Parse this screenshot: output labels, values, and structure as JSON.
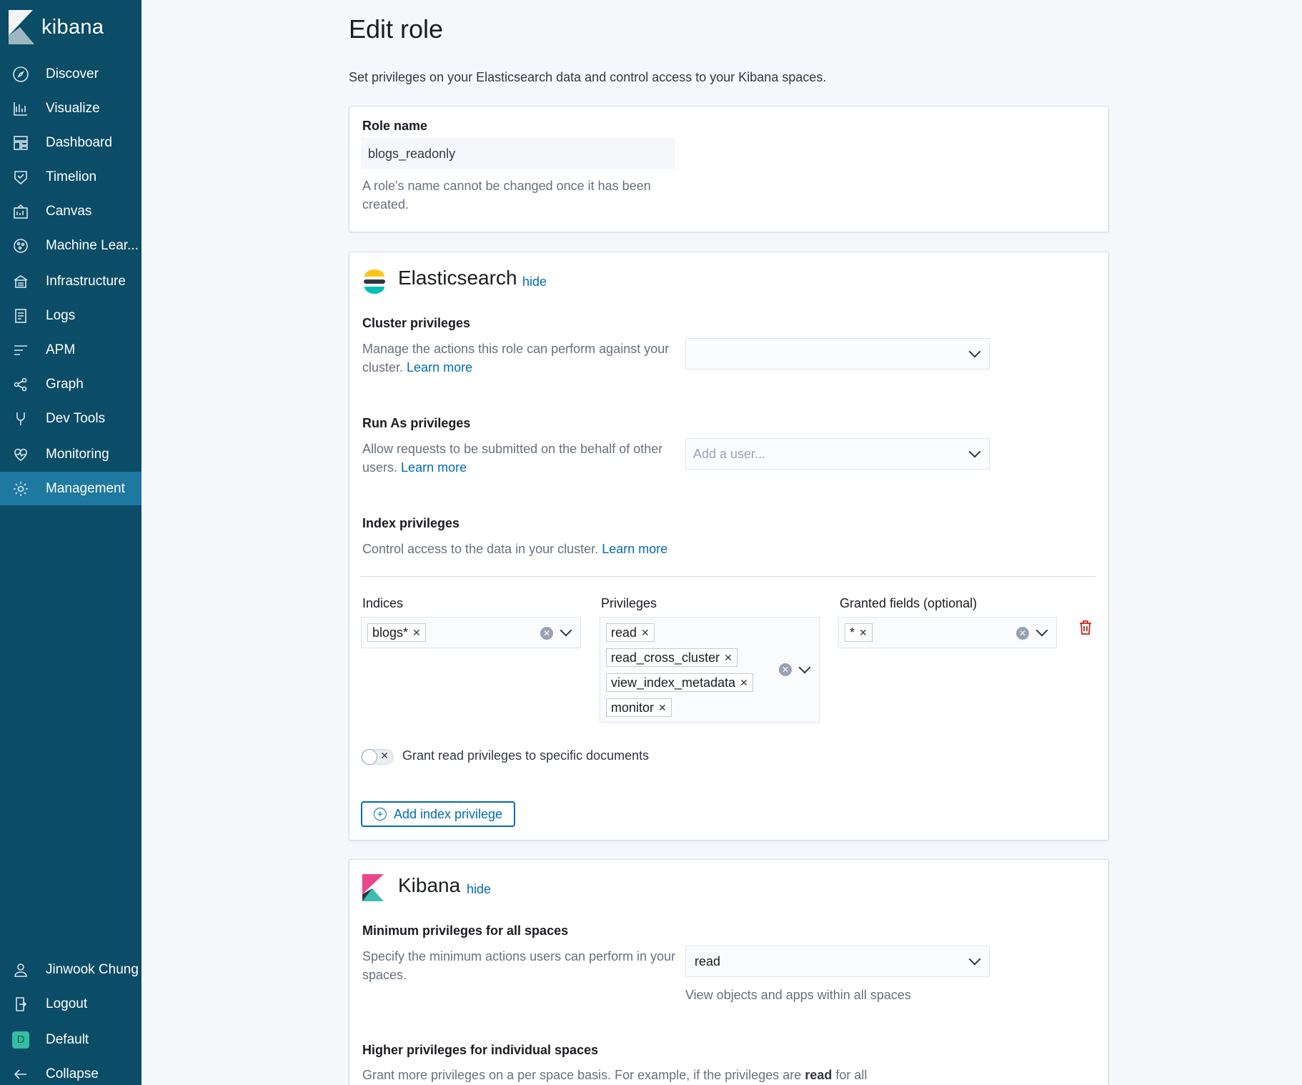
{
  "sidebar": {
    "brand": "kibana",
    "items": [
      {
        "label": "Discover",
        "icon": "compass-icon"
      },
      {
        "label": "Visualize",
        "icon": "visualize-icon"
      },
      {
        "label": "Dashboard",
        "icon": "dashboard-icon"
      },
      {
        "label": "Timelion",
        "icon": "timelion-icon"
      },
      {
        "label": "Canvas",
        "icon": "canvas-icon"
      },
      {
        "label": "Machine Lear...",
        "icon": "machine-learning-icon"
      },
      {
        "label": "Infrastructure",
        "icon": "infrastructure-icon"
      },
      {
        "label": "Logs",
        "icon": "logs-icon"
      },
      {
        "label": "APM",
        "icon": "apm-icon"
      },
      {
        "label": "Graph",
        "icon": "graph-icon"
      },
      {
        "label": "Dev Tools",
        "icon": "wrench-icon"
      },
      {
        "label": "Monitoring",
        "icon": "heartbeat-icon"
      },
      {
        "label": "Management",
        "icon": "gear-icon",
        "active": true
      }
    ],
    "bottom": [
      {
        "label": "Jinwook Chung",
        "icon": "user-icon"
      },
      {
        "label": "Logout",
        "icon": "logout-icon"
      },
      {
        "label": "Default",
        "icon": "space-badge",
        "badge": "D"
      },
      {
        "label": "Collapse",
        "icon": "arrow-left-icon"
      }
    ]
  },
  "page": {
    "title": "Edit role",
    "description": "Set privileges on your Elasticsearch data and control access to your Kibana spaces."
  },
  "role_panel": {
    "label": "Role name",
    "value": "blogs_readonly",
    "help": "A role's name cannot be changed once it has been created."
  },
  "es_panel": {
    "title": "Elasticsearch",
    "hide": "hide",
    "cluster": {
      "label": "Cluster privileges",
      "help": "Manage the actions this role can perform against your cluster.",
      "learn_more": "Learn more",
      "value": ""
    },
    "runas": {
      "label": "Run As privileges",
      "help": "Allow requests to be submitted on the behalf of other users.",
      "learn_more": "Learn more",
      "placeholder": "Add a user..."
    },
    "index": {
      "label": "Index privileges",
      "help": "Control access to the data in your cluster.",
      "learn_more": "Learn more",
      "indices_label": "Indices",
      "indices": [
        "blogs*"
      ],
      "privileges_label": "Privileges",
      "privileges": [
        "read",
        "read_cross_cluster",
        "view_index_metadata",
        "monitor"
      ],
      "fields_label": "Granted fields (optional)",
      "fields": [
        "*"
      ],
      "toggle_label": "Grant read privileges to specific documents",
      "add_button": "Add index privilege"
    }
  },
  "kibana_panel": {
    "title": "Kibana",
    "hide": "hide",
    "min": {
      "label": "Minimum privileges for all spaces",
      "help": "Specify the minimum actions users can perform in your spaces.",
      "value": "read",
      "value_help": "View objects and apps within all spaces"
    },
    "higher": {
      "label": "Higher privileges for individual spaces",
      "help_pre": "Grant more privileges on a per space basis. For example, if the privileges are",
      "help_bold": "read",
      "help_post": "for all"
    }
  },
  "colors": {
    "sidebar_bg": "#0b4c66",
    "sidebar_active": "#1f78a0",
    "link": "#006bb4",
    "danger": "#bd271e",
    "elastic_yellow": "#fec514",
    "elastic_teal": "#00bfb3",
    "kibana_pink": "#e8488b",
    "kibana_teal": "#3ebeb0"
  }
}
